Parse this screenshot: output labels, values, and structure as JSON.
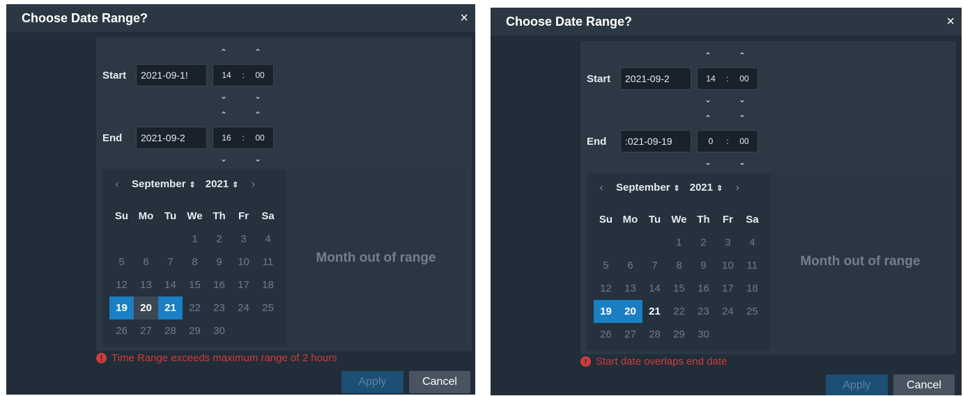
{
  "dialogs": [
    {
      "title": "Choose Date Range?",
      "close_icon": "×",
      "start_label": "Start",
      "start_date": "2021-09-1!",
      "start_hour": "14",
      "start_minute": "00",
      "end_label": "End",
      "end_date": "2021-09-2",
      "end_hour": "16",
      "end_minute": "00",
      "time_sep": ":",
      "up": "⌃",
      "down": "⌄",
      "month": "September",
      "year": "2021",
      "prev": "‹",
      "next": "›",
      "sort": "⇕",
      "weekdays": [
        "Su",
        "Mo",
        "Tu",
        "We",
        "Th",
        "Fr",
        "Sa"
      ],
      "out_of_range": "Month out of range",
      "error": "Time Range exceeds maximum range of 2 hours",
      "apply": "Apply",
      "cancel": "Cancel",
      "selected_start": 19,
      "selected_end": 21,
      "in_range_day": 20
    },
    {
      "title": "Choose Date Range?",
      "close_icon": "×",
      "start_label": "Start",
      "start_date": "2021-09-2",
      "start_hour": "14",
      "start_minute": "00",
      "end_label": "End",
      "end_date": ":021-09-19",
      "end_hour": "0",
      "end_minute": "00",
      "time_sep": ":",
      "up": "⌃",
      "down": "⌄",
      "month": "September",
      "year": "2021",
      "prev": "‹",
      "next": "›",
      "sort": "⇕",
      "weekdays": [
        "Su",
        "Mo",
        "Tu",
        "We",
        "Th",
        "Fr",
        "Sa"
      ],
      "out_of_range": "Month out of range",
      "error": "Start date overlaps end date",
      "apply": "Apply",
      "cancel": "Cancel",
      "selected_start": 19,
      "selected_end": 20,
      "bright_day": 21
    }
  ],
  "calendar": {
    "first_weekday": 3,
    "days_in_month": 30
  },
  "colors": {
    "accent": "#1b7fc4",
    "error": "#d23b3b",
    "background": "#212d38"
  }
}
